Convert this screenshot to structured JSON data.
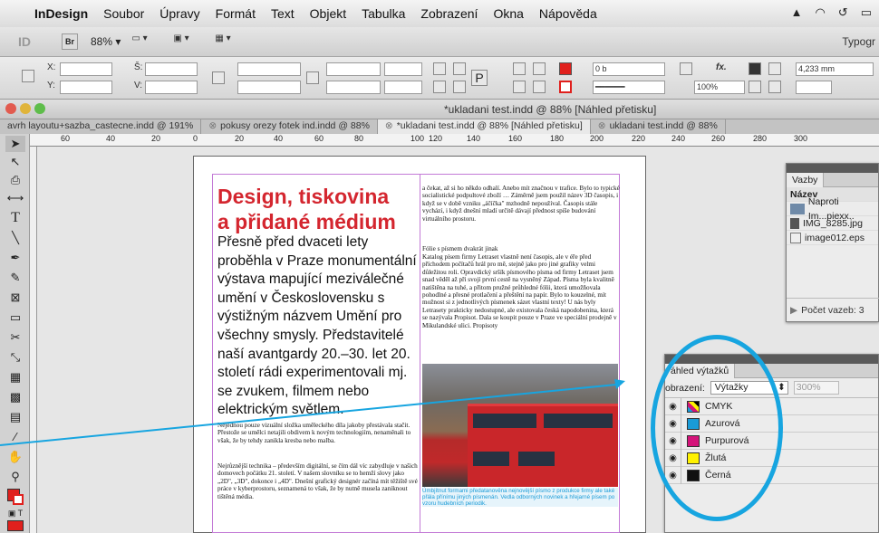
{
  "menubar": {
    "items": [
      "InDesign",
      "Soubor",
      "Úpravy",
      "Formát",
      "Text",
      "Objekt",
      "Tabulka",
      "Zobrazení",
      "Okna",
      "Nápověda"
    ]
  },
  "appbar": {
    "logo": "ID",
    "bridge": "Br",
    "zoom": "88%",
    "workspace": "Typogr"
  },
  "control": {
    "x_label": "X:",
    "y_label": "Y:",
    "w_label": "Š:",
    "h_label": "V:",
    "stroke_weight": "0 b",
    "opacity": "100%",
    "gutter": "4,233 mm"
  },
  "document": {
    "title": "*ukladani test.indd @ 88% [Náhled přetisku]"
  },
  "tabs": [
    {
      "label": "avrh layoutu+sazba_castecne.indd @ 191%",
      "active": false
    },
    {
      "label": "pokusy orezy fotek ind.indd @ 88%",
      "active": false
    },
    {
      "label": "*ukladani test.indd @ 88% [Náhled přetisku]",
      "active": true
    },
    {
      "label": "ukladani test.indd @ 88%",
      "active": false
    }
  ],
  "ruler": {
    "ticks": [
      "60",
      "40",
      "20",
      "0",
      "20",
      "40",
      "60",
      "80",
      "100",
      "120",
      "140",
      "160",
      "180",
      "200",
      "220",
      "240",
      "260",
      "280",
      "300"
    ]
  },
  "article": {
    "headline_1": "Design, tiskovina",
    "headline_2": "a přidané médium",
    "lead": "Přesně před dvaceti lety proběhla v Praze monumentální výstava mapující meziválečné umění v Československu s výstižným názvem Umění pro všechny smysly. Představitelé naší avantgardy 20.–30. let 20. století rádi experimentovali mj. se zvukem, filmem nebo elektrickým světlem.",
    "para_1": "Nejednou pouze vizuální složka uměleckého díla jakoby přestávala stačit. Přestože se umělci netajili obdivem k novým technologiím, nenaměnali to však, že by tehdy zanikla kresba nebo malba.",
    "para_2": "Nejrůznější technika – především digitální, se čím dál víc zabydluje v našich domovech počátku 21. století. V našem slovníku se to hemží slovy jako „2D\", „3D\", dokonce i „4D\". Dnešní grafický designér začíná mít těžiště své práce v kyberprostoru, seznamená to však, že by nutně musela zaniknout tištěná média.",
    "col2_para_1": "a čekat, až si ho někdo odhalí. Anebo mít značnou v trafice. Bylo to typické socialistické podpultové zboží … Záměrně jsem použil název 3D časopis, i když se v době vzniku „áčíčka\" mzhodně nepoužíval. Časopis stále vychází, i když dnešní mladí určitě dávají přednost spíše budování virtuálního prostoru.",
    "col2_heading": "Fólie s písmem dvakrát jinak",
    "col2_para_2": "Katalog písem firmy Letraset vlastně není časopis, ale v éře před příchodem počítačů hrál pro mě, stejně jako pro jiné grafiky velmi důležitou roli. Opravdický sršík písmového písma od firmy Letraset jsem snad věděl až při svojí první cestě na vysněný Západ. Písma byla kvalitně natištěna na tuhé, a přitom pružné průhledné fólii, která umožňovala pohodlné a přesné protlačení a přeštění na papír. Bylo to kouzelné, mít možnost si z jednotlivých písmenek sázet vlastní texty! U nás byly Letrasety prakticky nedostupné, ale existovala česká napodobenina, která se nazývala Propisot. Dala se koupit pouze v Praze ve speciální prodejně v Mikulandské ulici. Propisoty",
    "caption": "Úmbjítnut formami předatanověna nejnovější písmo z produkce firmy ale také přála přínímu jiných písmenán. Vedla odborných novinek a hřejarné písem po vzoru hudebních periodik."
  },
  "links_panel": {
    "tab": "Vazby",
    "column": "Název",
    "items": [
      {
        "name": "Naproti Im...piexx.."
      },
      {
        "name": "IMG_8285.jpg"
      },
      {
        "name": "image012.eps"
      }
    ],
    "footer": "Počet vazeb: 3"
  },
  "separations_panel": {
    "tab": "áhled výtažků",
    "view_label": "obrazení:",
    "view_value": "Výtažky",
    "zoom_value": "300%",
    "items": [
      {
        "name": "CMYK",
        "color": "#000000"
      },
      {
        "name": "Azurová",
        "color": "#1a9bd7"
      },
      {
        "name": "Purpurová",
        "color": "#d4147a"
      },
      {
        "name": "Žlutá",
        "color": "#fff200"
      },
      {
        "name": "Černá",
        "color": "#111111"
      }
    ]
  },
  "colors": {
    "headline_red": "#d4262f",
    "callout_blue": "#17a5e0"
  }
}
